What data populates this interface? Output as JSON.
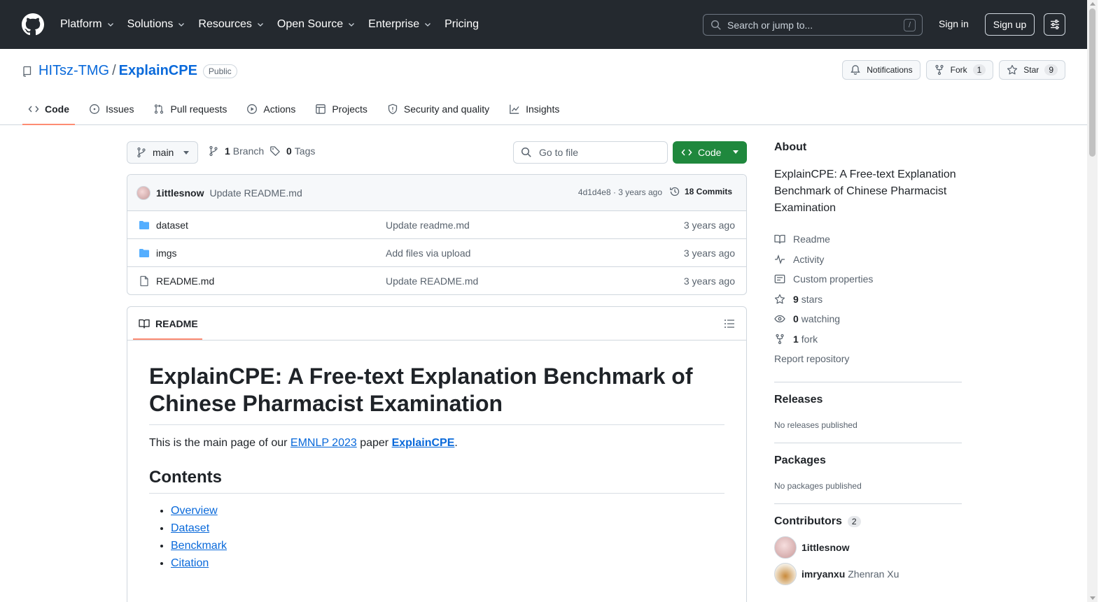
{
  "header": {
    "nav": [
      {
        "label": "Platform",
        "dropdown": true
      },
      {
        "label": "Solutions",
        "dropdown": true
      },
      {
        "label": "Resources",
        "dropdown": true
      },
      {
        "label": "Open Source",
        "dropdown": true
      },
      {
        "label": "Enterprise",
        "dropdown": true
      },
      {
        "label": "Pricing",
        "dropdown": false
      }
    ],
    "search_placeholder": "Search or jump to...",
    "search_key": "/",
    "sign_in": "Sign in",
    "sign_up": "Sign up"
  },
  "repo": {
    "owner": "HITsz-TMG",
    "separator": "/",
    "name": "ExplainCPE",
    "visibility": "Public",
    "notifications_label": "Notifications",
    "fork_label": "Fork",
    "fork_count": "1",
    "star_label": "Star",
    "star_count": "9",
    "tabs": [
      {
        "label": "Code",
        "icon": "code-icon",
        "active": true
      },
      {
        "label": "Issues",
        "icon": "issue-icon"
      },
      {
        "label": "Pull requests",
        "icon": "pull-request-icon"
      },
      {
        "label": "Actions",
        "icon": "play-icon"
      },
      {
        "label": "Projects",
        "icon": "table-icon"
      },
      {
        "label": "Security and quality",
        "icon": "shield-icon"
      },
      {
        "label": "Insights",
        "icon": "graph-icon"
      }
    ]
  },
  "toolbar": {
    "branch": "main",
    "branch_count": "1",
    "branch_label": "Branch",
    "tag_count": "0",
    "tag_label": "Tags",
    "goto_placeholder": "Go to file",
    "code_button": "Code"
  },
  "latest_commit": {
    "author": "1ittlesnow",
    "message": "Update README.md",
    "hash_time": "4d1d4e8 · 3 years ago",
    "commits": "18 Commits"
  },
  "files": [
    {
      "name": "dataset",
      "type": "folder",
      "message": "Update readme.md",
      "time": "3 years ago"
    },
    {
      "name": "imgs",
      "type": "folder",
      "message": "Add files via upload",
      "time": "3 years ago"
    },
    {
      "name": "README.md",
      "type": "file",
      "message": "Update README.md",
      "time": "3 years ago"
    }
  ],
  "readme": {
    "tab_label": "README",
    "title": "ExplainCPE: A Free-text Explanation Benchmark of Chinese Pharmacist Examination",
    "intro_prefix": "This is the main page of our ",
    "intro_link1": "EMNLP 2023",
    "intro_mid": " paper ",
    "intro_link2": "ExplainCPE",
    "intro_suffix": ".",
    "contents_heading": "Contents",
    "contents": [
      "Overview",
      "Dataset",
      "Benckmark",
      "Citation"
    ]
  },
  "sidebar": {
    "about_heading": "About",
    "about_desc": "ExplainCPE: A Free-text Explanation Benchmark of Chinese Pharmacist Examination",
    "items": [
      {
        "icon": "book-icon",
        "count": "",
        "label": "Readme"
      },
      {
        "icon": "pulse-icon",
        "count": "",
        "label": "Activity"
      },
      {
        "icon": "note-icon",
        "count": "",
        "label": "Custom properties"
      },
      {
        "icon": "star-icon",
        "count": "9",
        "label": "stars"
      },
      {
        "icon": "eye-icon",
        "count": "0",
        "label": "watching"
      },
      {
        "icon": "fork-icon",
        "count": "1",
        "label": "fork"
      }
    ],
    "report": "Report repository",
    "releases_heading": "Releases",
    "releases_text": "No releases published",
    "packages_heading": "Packages",
    "packages_text": "No packages published",
    "contributors_heading": "Contributors",
    "contributors_count": "2",
    "contributors": [
      {
        "login": "1ittlesnow",
        "name": ""
      },
      {
        "login": "imryanxu",
        "name": "Zhenran Xu"
      }
    ]
  },
  "colors": {
    "header_bg": "#24292f",
    "link": "#0969da",
    "primary_button": "#1f883d",
    "active_tab_underline": "#fd8c73"
  }
}
